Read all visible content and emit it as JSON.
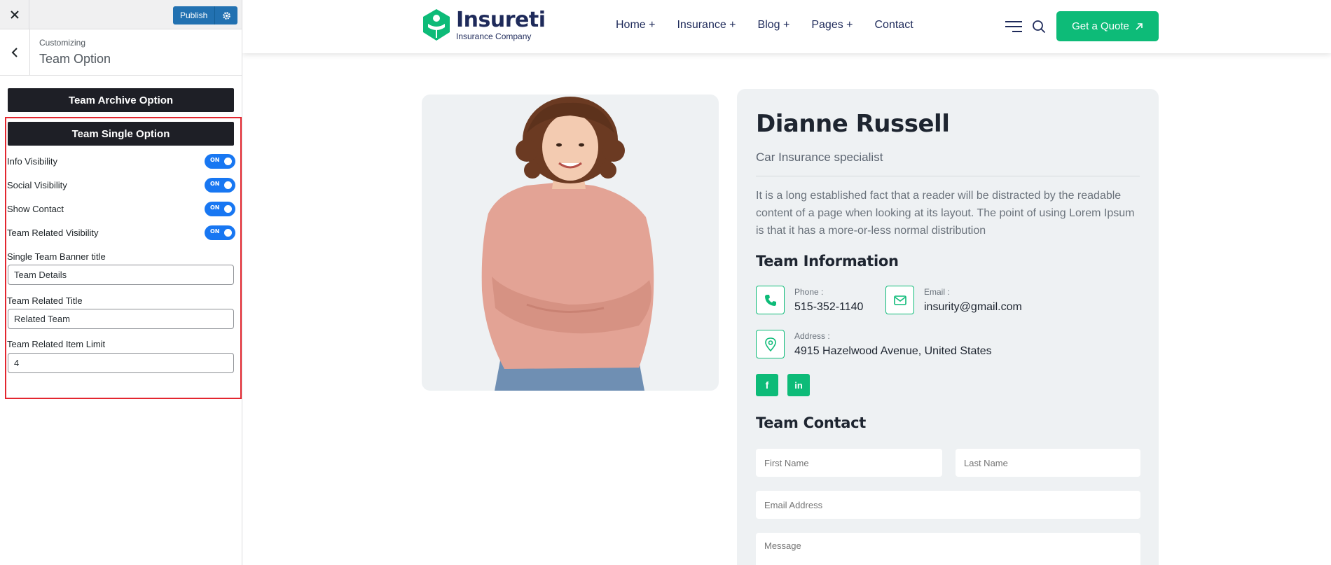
{
  "customizer": {
    "close_label": "×",
    "publish_label": "Publish",
    "breadcrumb": "Customizing",
    "title": "Team Option",
    "archive_button": "Team Archive Option",
    "single_button": "Team Single Option",
    "toggles": [
      {
        "label": "Info Visibility",
        "state": "ON"
      },
      {
        "label": "Social Visibility",
        "state": "ON"
      },
      {
        "label": "Show Contact",
        "state": "ON"
      },
      {
        "label": "Team Related Visibility",
        "state": "ON"
      }
    ],
    "fields": [
      {
        "label": "Single Team Banner title",
        "value": "Team Details"
      },
      {
        "label": "Team Related Title",
        "value": "Related Team"
      },
      {
        "label": "Team Related Item Limit",
        "value": "4"
      }
    ],
    "highlight_color": "#e3262f",
    "accent_color": "#2271b1"
  },
  "site": {
    "logo": {
      "name": "Insureti",
      "tagline": "Insurance Company"
    },
    "nav": [
      "Home +",
      "Insurance +",
      "Blog +",
      "Pages +",
      "Contact"
    ],
    "quote_button": "Get a Quote",
    "brand_color": "#0dbb78",
    "member": {
      "name": "Dianne Russell",
      "role": "Car Insurance specialist",
      "bio": "It is a long established fact that a reader will be distracted by the readable content of a page when looking at its layout. The point of using Lorem Ipsum is that it has a more-or-less normal distribution"
    },
    "team_info": {
      "title": "Team Information",
      "phone_label": "Phone :",
      "phone": "515-352-1140",
      "email_label": "Email :",
      "email": "insurity@gmail.com",
      "address_label": "Address :",
      "address": "4915 Hazelwood Avenue, United States"
    },
    "social": [
      {
        "icon": "facebook-icon",
        "glyph": "f"
      },
      {
        "icon": "linkedin-icon",
        "glyph": "in"
      }
    ],
    "contact": {
      "title": "Team Contact",
      "first_name_placeholder": "First Name",
      "last_name_placeholder": "Last Name",
      "email_placeholder": "Email Address",
      "message_placeholder": "Message"
    }
  }
}
